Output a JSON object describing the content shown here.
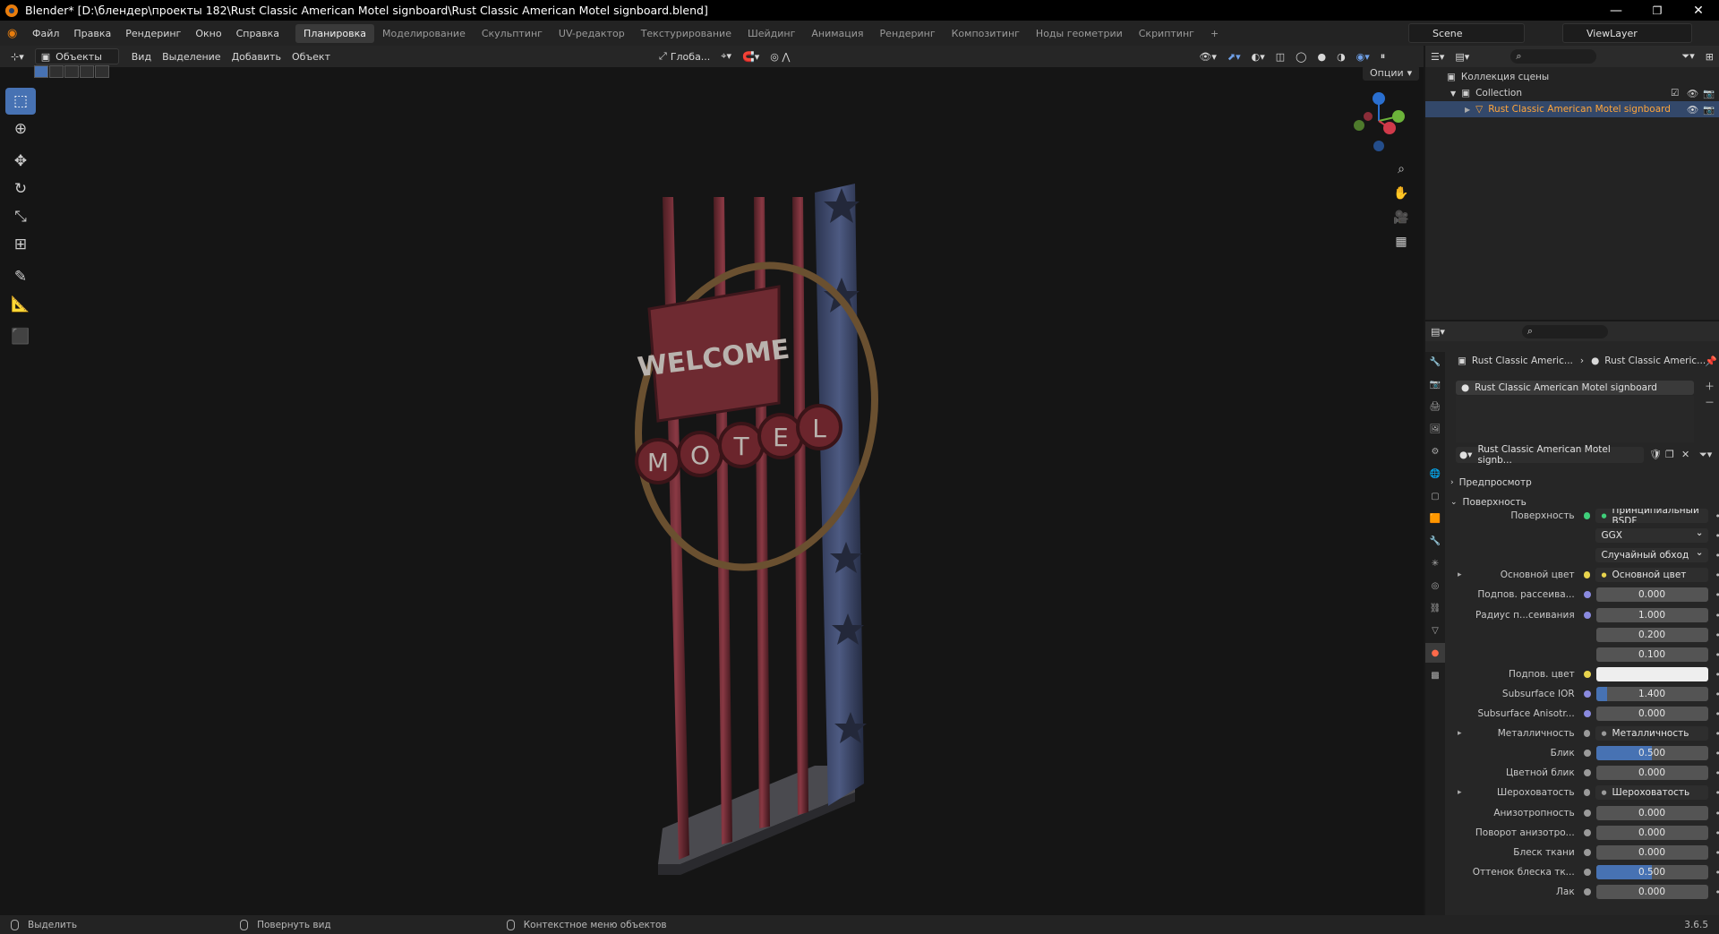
{
  "window": {
    "title": "Blender* [D:\\блендер\\проекты 182\\Rust Classic American Motel signboard\\Rust Classic American Motel signboard.blend]",
    "minimize": "—",
    "maximize": "❐",
    "close": "✕"
  },
  "menu": [
    "Файл",
    "Правка",
    "Рендеринг",
    "Окно",
    "Справка"
  ],
  "workspaces": [
    "Планировка",
    "Моделирование",
    "Скульптинг",
    "UV-редактор",
    "Текстурирование",
    "Шейдинг",
    "Анимация",
    "Рендеринг",
    "Композитинг",
    "Ноды геометрии",
    "Скриптинг",
    "+"
  ],
  "active_workspace_index": 0,
  "scene": "Scene",
  "view_layer": "ViewLayer",
  "viewport_header": {
    "mode": "Объекты",
    "items": [
      "Вид",
      "Выделение",
      "Добавить",
      "Объект"
    ],
    "transform": "Глоба...",
    "options": "Опции"
  },
  "tools": [
    "select-box",
    "cursor",
    "move",
    "rotate",
    "scale",
    "transform",
    "annotate",
    "measure",
    "add-cube"
  ],
  "viewport": {
    "sign_words": {
      "welcome": "WELCOME",
      "motel": [
        "M",
        "O",
        "T",
        "E",
        "L"
      ]
    }
  },
  "outliner": {
    "root": "Коллекция сцены",
    "collection": "Collection",
    "object": "Rust Classic American Motel signboard"
  },
  "properties": {
    "breadcrumb": [
      "Rust Classic Americ...",
      "Rust Classic Americ..."
    ],
    "material_slot": "Rust Classic American Motel signboard",
    "material_name": "Rust Classic American Motel signb...",
    "panels": {
      "preview": "Предпросмотр",
      "surface": "Поверхность"
    },
    "rows": [
      {
        "label": "Поверхность",
        "value": "Принципиальный BSDF",
        "kind": "link",
        "dot": "#3fcf7a"
      },
      {
        "label": "",
        "value": "GGX",
        "kind": "select"
      },
      {
        "label": "",
        "value": "Случайный обход",
        "kind": "select"
      },
      {
        "label": "Основной цвет",
        "value": "Основной цвет",
        "kind": "link",
        "dot": "#e8d44d",
        "expand": true
      },
      {
        "label": "Подпов. рассеива...",
        "value": "0.000",
        "kind": "num",
        "dot": "#8a8adf"
      },
      {
        "label": "Радиус п...сеивания",
        "value": "1.000",
        "kind": "num",
        "dot": "#8a8adf"
      },
      {
        "label": "",
        "value": "0.200",
        "kind": "num"
      },
      {
        "label": "",
        "value": "0.100",
        "kind": "num"
      },
      {
        "label": "Подпов. цвет",
        "value": "",
        "kind": "color",
        "dot": "#e8d44d"
      },
      {
        "label": "Subsurface IOR",
        "value": "1.400",
        "kind": "num",
        "dot": "#8a8adf",
        "fill": 0.1
      },
      {
        "label": "Subsurface Anisotr...",
        "value": "0.000",
        "kind": "num",
        "dot": "#8a8adf"
      },
      {
        "label": "Металличность",
        "value": "Металличность",
        "kind": "link",
        "dot": "#9a9a9a",
        "expand": true
      },
      {
        "label": "Блик",
        "value": "0.500",
        "kind": "num",
        "dot": "#9a9a9a",
        "fill": 0.5
      },
      {
        "label": "Цветной блик",
        "value": "0.000",
        "kind": "num",
        "dot": "#9a9a9a"
      },
      {
        "label": "Шероховатость",
        "value": "Шероховатость",
        "kind": "link",
        "dot": "#9a9a9a",
        "expand": true
      },
      {
        "label": "Анизотропность",
        "value": "0.000",
        "kind": "num",
        "dot": "#9a9a9a"
      },
      {
        "label": "Поворот анизотро...",
        "value": "0.000",
        "kind": "num",
        "dot": "#9a9a9a"
      },
      {
        "label": "Блеск ткани",
        "value": "0.000",
        "kind": "num",
        "dot": "#9a9a9a"
      },
      {
        "label": "Оттенок блеска тк...",
        "value": "0.500",
        "kind": "num",
        "dot": "#9a9a9a",
        "fill": 0.5
      },
      {
        "label": "Лак",
        "value": "0.000",
        "kind": "num",
        "dot": "#9a9a9a"
      }
    ]
  },
  "status": {
    "left": "Выделить",
    "middle": "Повернуть вид",
    "right": "Контекстное меню объектов",
    "version": "3.6.5"
  }
}
